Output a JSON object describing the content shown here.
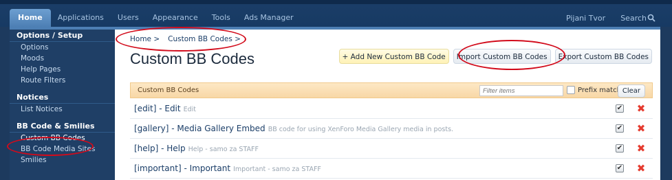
{
  "nav": {
    "tabs": [
      "Home",
      "Applications",
      "Users",
      "Appearance",
      "Tools",
      "Ads Manager"
    ],
    "active": "Home",
    "user": "Pijani Tvor",
    "search": "Search"
  },
  "sidebar": {
    "sections": [
      {
        "heading": "Options / Setup",
        "items": [
          "Options",
          "Moods",
          "Help Pages",
          "Route Filters"
        ]
      },
      {
        "heading": "Notices",
        "items": [
          "List Notices"
        ]
      },
      {
        "heading": "BB Code & Smilies",
        "items": [
          "Custom BB Codes",
          "BB Code Media Sites",
          "Smilies"
        ]
      }
    ],
    "active_item": "Custom BB Codes"
  },
  "breadcrumb": [
    "Home >",
    "Custom BB Codes >"
  ],
  "page_title": "Custom BB Codes",
  "buttons": {
    "add": "+ Add New Custom BB Code",
    "import": "Import Custom BB Codes",
    "export": "Export Custom BB Codes"
  },
  "list": {
    "header": "Custom BB Codes",
    "filter_placeholder": "Filter items",
    "prefix_label": "Prefix match",
    "clear": "Clear",
    "rows": [
      {
        "title": "[edit] - Edit",
        "desc": "Edit"
      },
      {
        "title": "[gallery] - Media Gallery Embed",
        "desc": "BB code for using XenForo Media Gallery media in posts."
      },
      {
        "title": "[help] - Help",
        "desc": "Help - samo za STAFF"
      },
      {
        "title": "[important] - Important",
        "desc": "Important - samo za STAFF"
      }
    ]
  },
  "icons": {
    "search": "search-icon",
    "delete": "delete-icon",
    "checkbox_checked": "checkbox-checked-icon"
  },
  "colors": {
    "annotation": "#d20b1b",
    "header_bg": "#173a63",
    "list_header": "#f8d7a6",
    "delete": "#e53b2f"
  }
}
